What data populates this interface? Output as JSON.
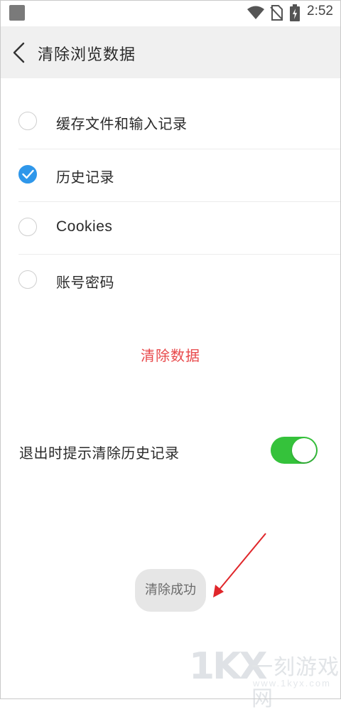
{
  "status_bar": {
    "time": "2:52"
  },
  "header": {
    "title": "清除浏览数据"
  },
  "options": [
    {
      "label": "缓存文件和输入记录",
      "checked": false
    },
    {
      "label": "历史记录",
      "checked": true
    },
    {
      "label": "Cookies",
      "checked": false
    },
    {
      "label": "账号密码",
      "checked": false
    }
  ],
  "clear_button": {
    "label": "清除数据"
  },
  "exit_prompt": {
    "label": "退出时提示清除历史记录",
    "enabled": true
  },
  "toast": {
    "message": "清除成功"
  },
  "watermark": {
    "logo": "1KX",
    "name": "一刻游戏网",
    "url": "www.1kyx.com"
  },
  "colors": {
    "accent_blue": "#2f97ea",
    "danger_red": "#e8494b",
    "toggle_green": "#35c23b",
    "header_bg": "#f0f0f0",
    "annotation_arrow": "#e0262a"
  }
}
